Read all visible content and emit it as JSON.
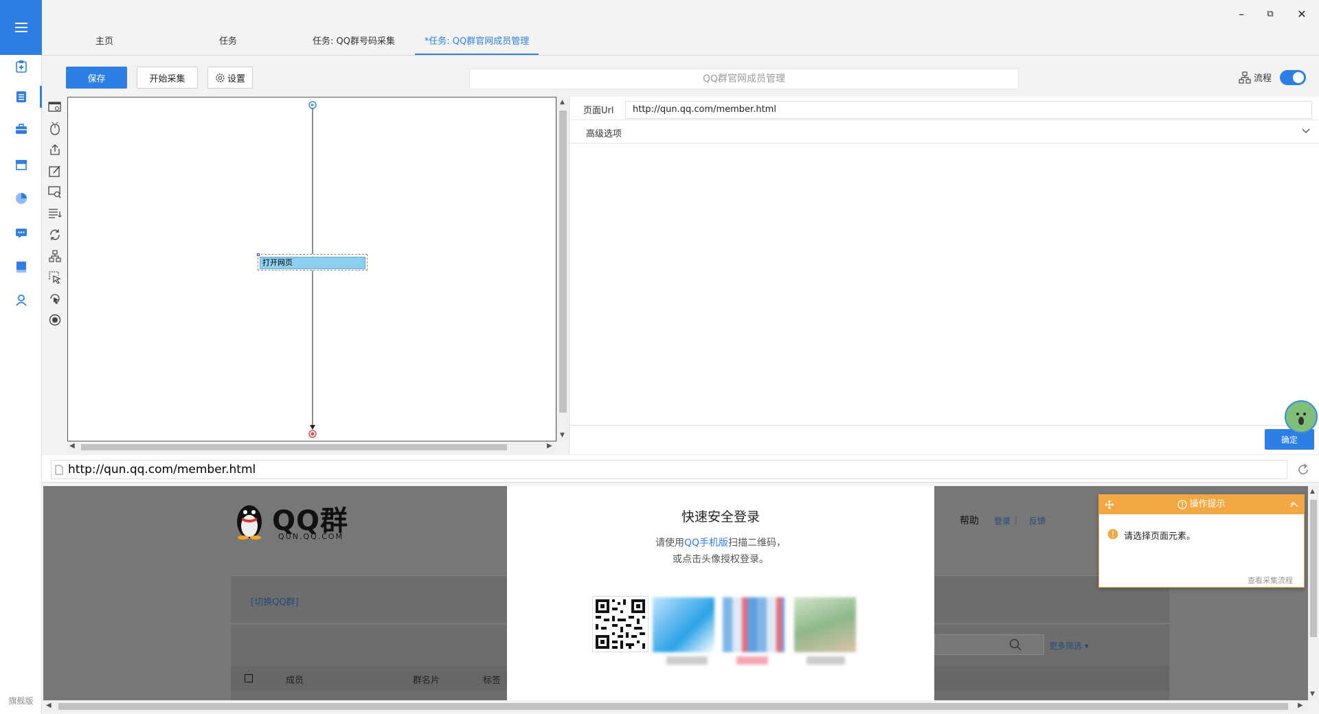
{
  "window": {
    "minimize_label": "–",
    "restore_label": "⧉",
    "close_label": "✕"
  },
  "rail": {
    "edition_label": "旗舰版",
    "items": [
      "clipboard-icon",
      "document-icon",
      "briefcase-icon",
      "store-icon",
      "pie-chart-icon",
      "chat-icon",
      "book-icon",
      "user-icon"
    ]
  },
  "tabs": [
    {
      "label": "主页"
    },
    {
      "label": "任务"
    },
    {
      "label": "任务: QQ群号码采集"
    },
    {
      "label": "*任务: QQ群官网成员管理"
    }
  ],
  "toolbar": {
    "save_label": "保存",
    "start_label": "开始采集",
    "settings_label": "设置",
    "task_title": "QQ群官网成员管理",
    "flow_label": "流程",
    "flow_enabled": true
  },
  "tools": [
    "open-page-icon",
    "click-icon",
    "export-icon",
    "input-text-icon",
    "recognize-icon",
    "extract-data-icon",
    "loop-icon",
    "branch-icon",
    "select-element-icon",
    "mouse-hover-icon",
    "stop-icon"
  ],
  "canvas": {
    "step_label": "打开网页"
  },
  "properties": {
    "page_url_label": "页面Url",
    "page_url_value": "http://qun.qq.com/member.html",
    "advanced_label": "高级选项",
    "confirm_label": "确定"
  },
  "browser": {
    "address": "http://qun.qq.com/member.html",
    "logo_text": "QQ群",
    "logo_sub": "QUN.QQ.COM",
    "switch_group": "[切换QQ群]",
    "help": "帮助",
    "login_link": "登录",
    "feedback": "反馈",
    "more_filter": "更多筛选 ▾",
    "col_member": "成员",
    "col_card": "群名片",
    "col_tag": "标签",
    "login_title": "快速安全登录",
    "login_line1_pre": "请使用",
    "login_line1_link": "QQ手机版",
    "login_line1_post": "扫描二维码，",
    "login_line2": "或点击头像授权登录。"
  },
  "tip": {
    "title": "操作提示",
    "message": "请选择页面元素。",
    "link": "查看采集流程"
  },
  "colors": {
    "accent": "#2d7fe5",
    "tip": "#f3a742"
  }
}
